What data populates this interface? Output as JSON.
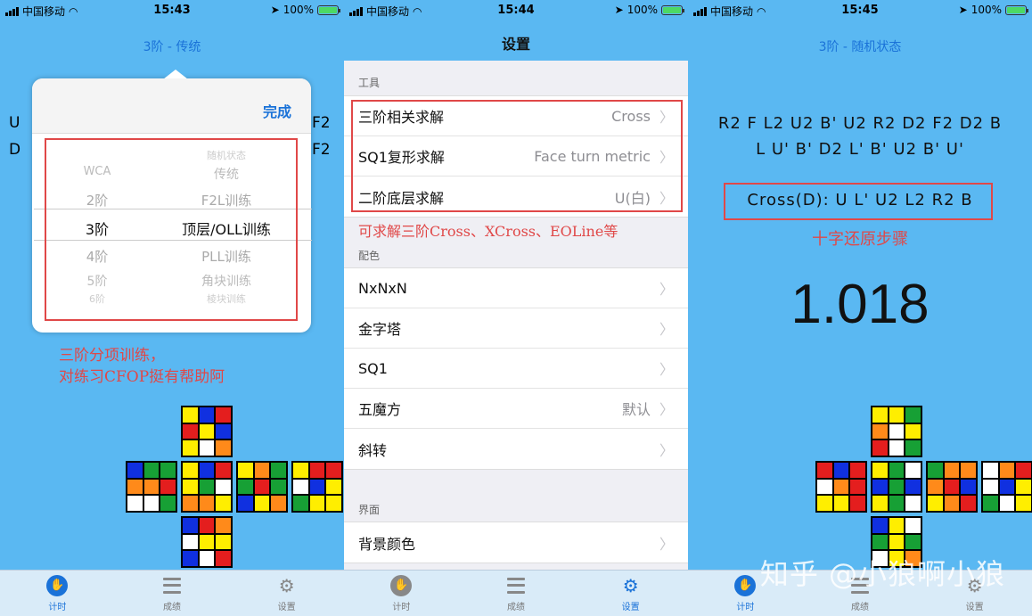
{
  "status": [
    {
      "carrier": "中国移动",
      "time": "15:43",
      "battery": "100%"
    },
    {
      "carrier": "中国移动",
      "time": "15:44",
      "battery": "100%"
    },
    {
      "carrier": "中国移动",
      "time": "15:45",
      "battery": "100%"
    }
  ],
  "screen1": {
    "title": "3阶 - 传统",
    "side_left": [
      "U",
      "D"
    ],
    "side_right": [
      "F2",
      "F2"
    ],
    "picker": {
      "done_label": "完成",
      "col1": [
        "WCA",
        "2阶",
        "3阶",
        "4阶",
        "5阶",
        "6阶"
      ],
      "col2": [
        "随机状态",
        "传统",
        "F2L训练",
        "顶层/OLL训练",
        "PLL训练",
        "角块训练",
        "棱块训练"
      ],
      "selected_col1": "3阶",
      "selected_col2": "顶层/OLL训练"
    },
    "annotation": [
      "三阶分项训练，",
      "对练习CFOP挺有帮助阿"
    ]
  },
  "screen2": {
    "title": "设置",
    "sections": [
      {
        "header": "工具",
        "items": [
          {
            "label": "三阶相关求解",
            "value": "Cross"
          },
          {
            "label": "SQ1复形求解",
            "value": "Face turn metric"
          },
          {
            "label": "二阶底层求解",
            "value": "U(白)"
          }
        ]
      },
      {
        "header": "配色",
        "items": [
          {
            "label": "NxNxN",
            "value": ""
          },
          {
            "label": "金字塔",
            "value": ""
          },
          {
            "label": "SQ1",
            "value": ""
          },
          {
            "label": "五魔方",
            "value": "默认"
          },
          {
            "label": "斜转",
            "value": ""
          }
        ]
      },
      {
        "header": "界面",
        "items": [
          {
            "label": "背景颜色",
            "value": ""
          }
        ]
      }
    ],
    "annotation": "可求解三阶Cross、XCross、EOLine等"
  },
  "screen3": {
    "title": "3阶 - 随机状态",
    "scramble_line1": "R2  F  L2  U2  B'  U2  R2  D2  F2  D2  B",
    "scramble_line2": "L  U'  B'  D2  L'  B'  U2  B'  U'",
    "cross_solution": "Cross(D):  U  L'  U2  L2  R2  B",
    "annotation": "十字还原步骤",
    "timer": "1.018",
    "watermark": "知乎 @小狼啊小狼"
  },
  "tabs": [
    {
      "label": "计时",
      "icon": "hand-icon"
    },
    {
      "label": "成绩",
      "icon": "list-icon"
    },
    {
      "label": "设置",
      "icon": "gear-icon"
    }
  ],
  "colors": {
    "accent": "#1a72d8",
    "bg": "#5ab8f2",
    "annotation": "#e04848"
  },
  "cube1": {
    "U": [
      "y",
      "b",
      "r",
      "r",
      "y",
      "b",
      "y",
      "w",
      "o"
    ],
    "L": [
      "b",
      "g",
      "g",
      "o",
      "o",
      "r",
      "w",
      "w",
      "g"
    ],
    "F": [
      "y",
      "b",
      "r",
      "y",
      "g",
      "w",
      "o",
      "o",
      "y"
    ],
    "R": [
      "y",
      "o",
      "g",
      "g",
      "r",
      "g",
      "b",
      "y",
      "o"
    ],
    "B": [
      "y",
      "r",
      "r",
      "w",
      "b",
      "y",
      "g",
      "y",
      "y"
    ],
    "D": [
      "b",
      "r",
      "o",
      "w",
      "y",
      "y",
      "b",
      "w",
      "r"
    ]
  },
  "cube3": {
    "U": [
      "y",
      "y",
      "g",
      "o",
      "w",
      "y",
      "r",
      "w",
      "g"
    ],
    "L": [
      "r",
      "b",
      "r",
      "w",
      "o",
      "r",
      "y",
      "y",
      "r"
    ],
    "F": [
      "y",
      "g",
      "w",
      "b",
      "g",
      "b",
      "y",
      "g",
      "w"
    ],
    "R": [
      "g",
      "o",
      "o",
      "o",
      "r",
      "b",
      "y",
      "o",
      "r"
    ],
    "B": [
      "w",
      "o",
      "r",
      "w",
      "b",
      "y",
      "g",
      "w",
      "y"
    ],
    "D": [
      "b",
      "y",
      "w",
      "g",
      "y",
      "g",
      "w",
      "y",
      "o"
    ]
  }
}
